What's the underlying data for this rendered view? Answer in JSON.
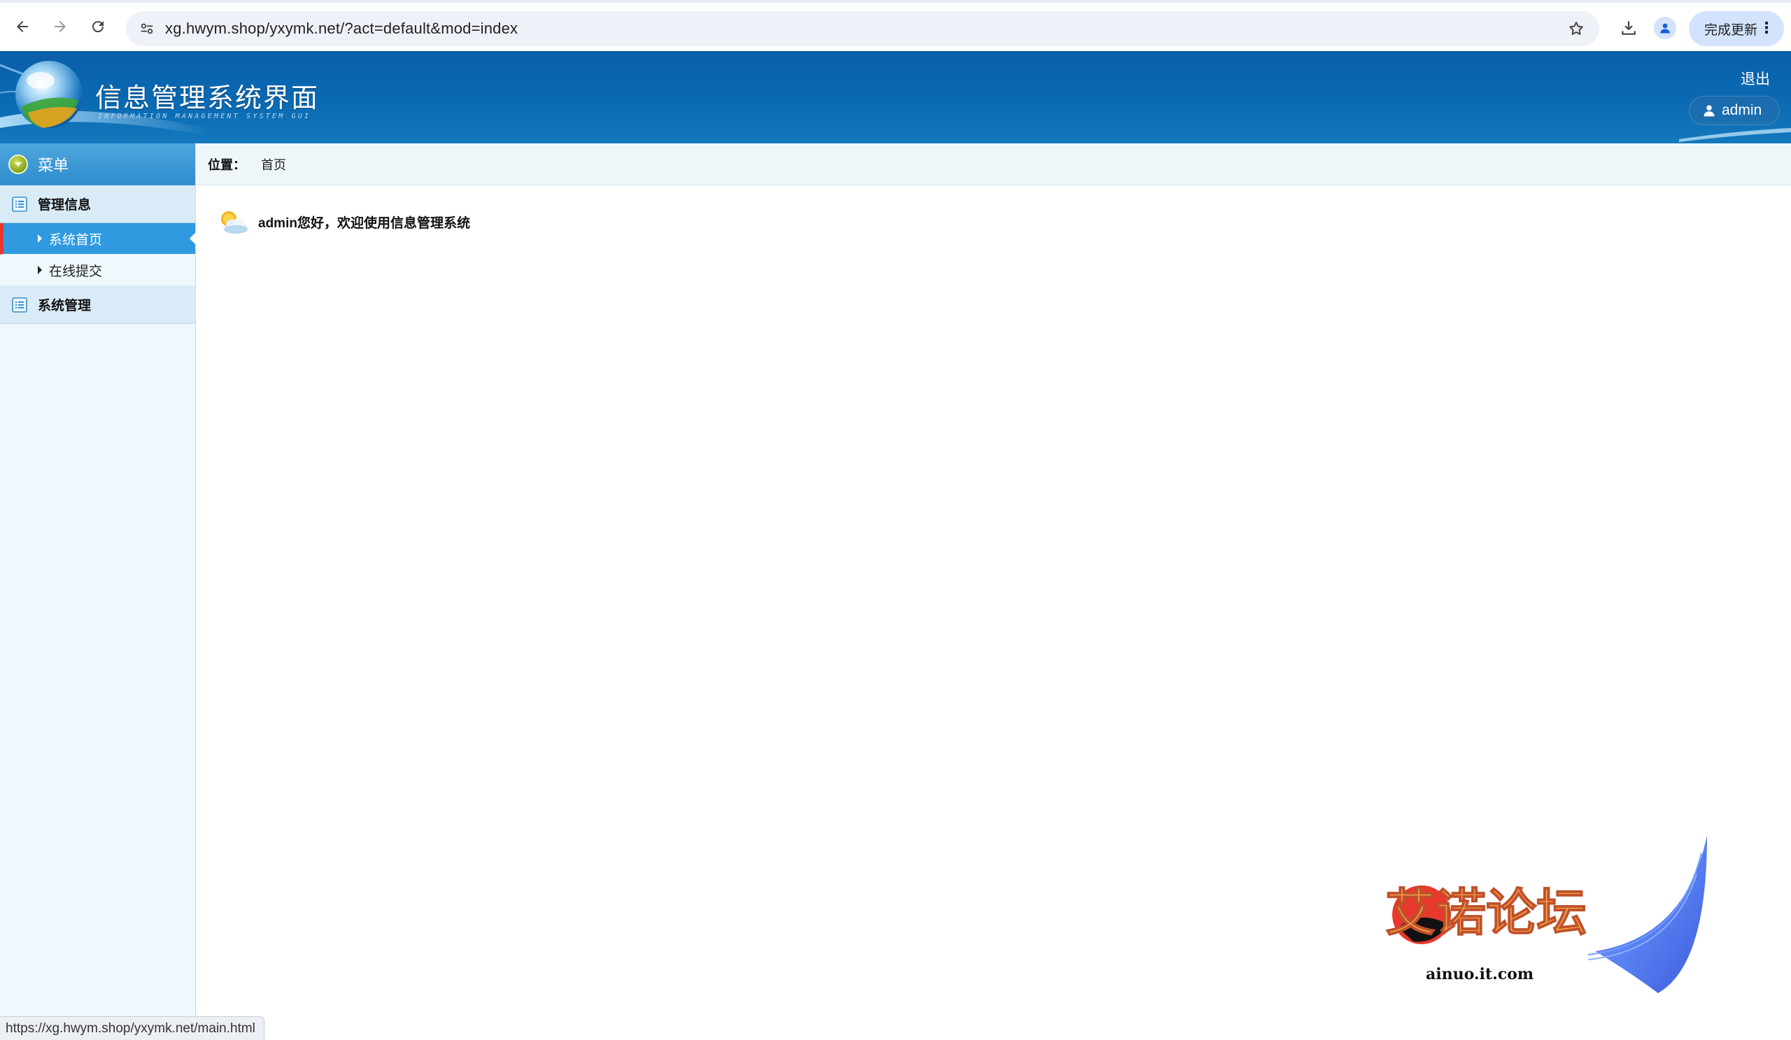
{
  "browser": {
    "url": "xg.hwym.shop/yxymk.net/?act=default&mod=index",
    "update_label": "完成更新",
    "icons": [
      "back-arrow-icon",
      "forward-arrow-icon",
      "reload-icon",
      "site-settings-icon",
      "bookmark-star-icon",
      "download-icon",
      "profile-icon",
      "kebab-menu-icon"
    ],
    "accent": "#d3e3fd"
  },
  "header": {
    "title": "信息管理系统界面",
    "subtitle": "INFORMATION MANAGEMENT SYSTEM GUI",
    "logout": "退出",
    "user": "admin",
    "bg_color": "#0a6ab3"
  },
  "sidebar": {
    "menu_title": "菜单",
    "groups": [
      {
        "label": "管理信息",
        "items": [
          {
            "label": "系统首页",
            "active": true
          },
          {
            "label": "在线提交",
            "active": false
          }
        ]
      },
      {
        "label": "系统管理",
        "items": []
      }
    ],
    "active_color": "#2f9ae0",
    "active_marker_color": "#e83a2a"
  },
  "main": {
    "breadcrumb_label": "位置：",
    "breadcrumb_value": "首页",
    "welcome": "admin您好，欢迎使用信息管理系统"
  },
  "watermark": {
    "brand": "艾诺论坛",
    "site": "ainuo.it.com"
  },
  "status_bar": {
    "hover_url": "https://xg.hwym.shop/yxymk.net/main.html"
  }
}
